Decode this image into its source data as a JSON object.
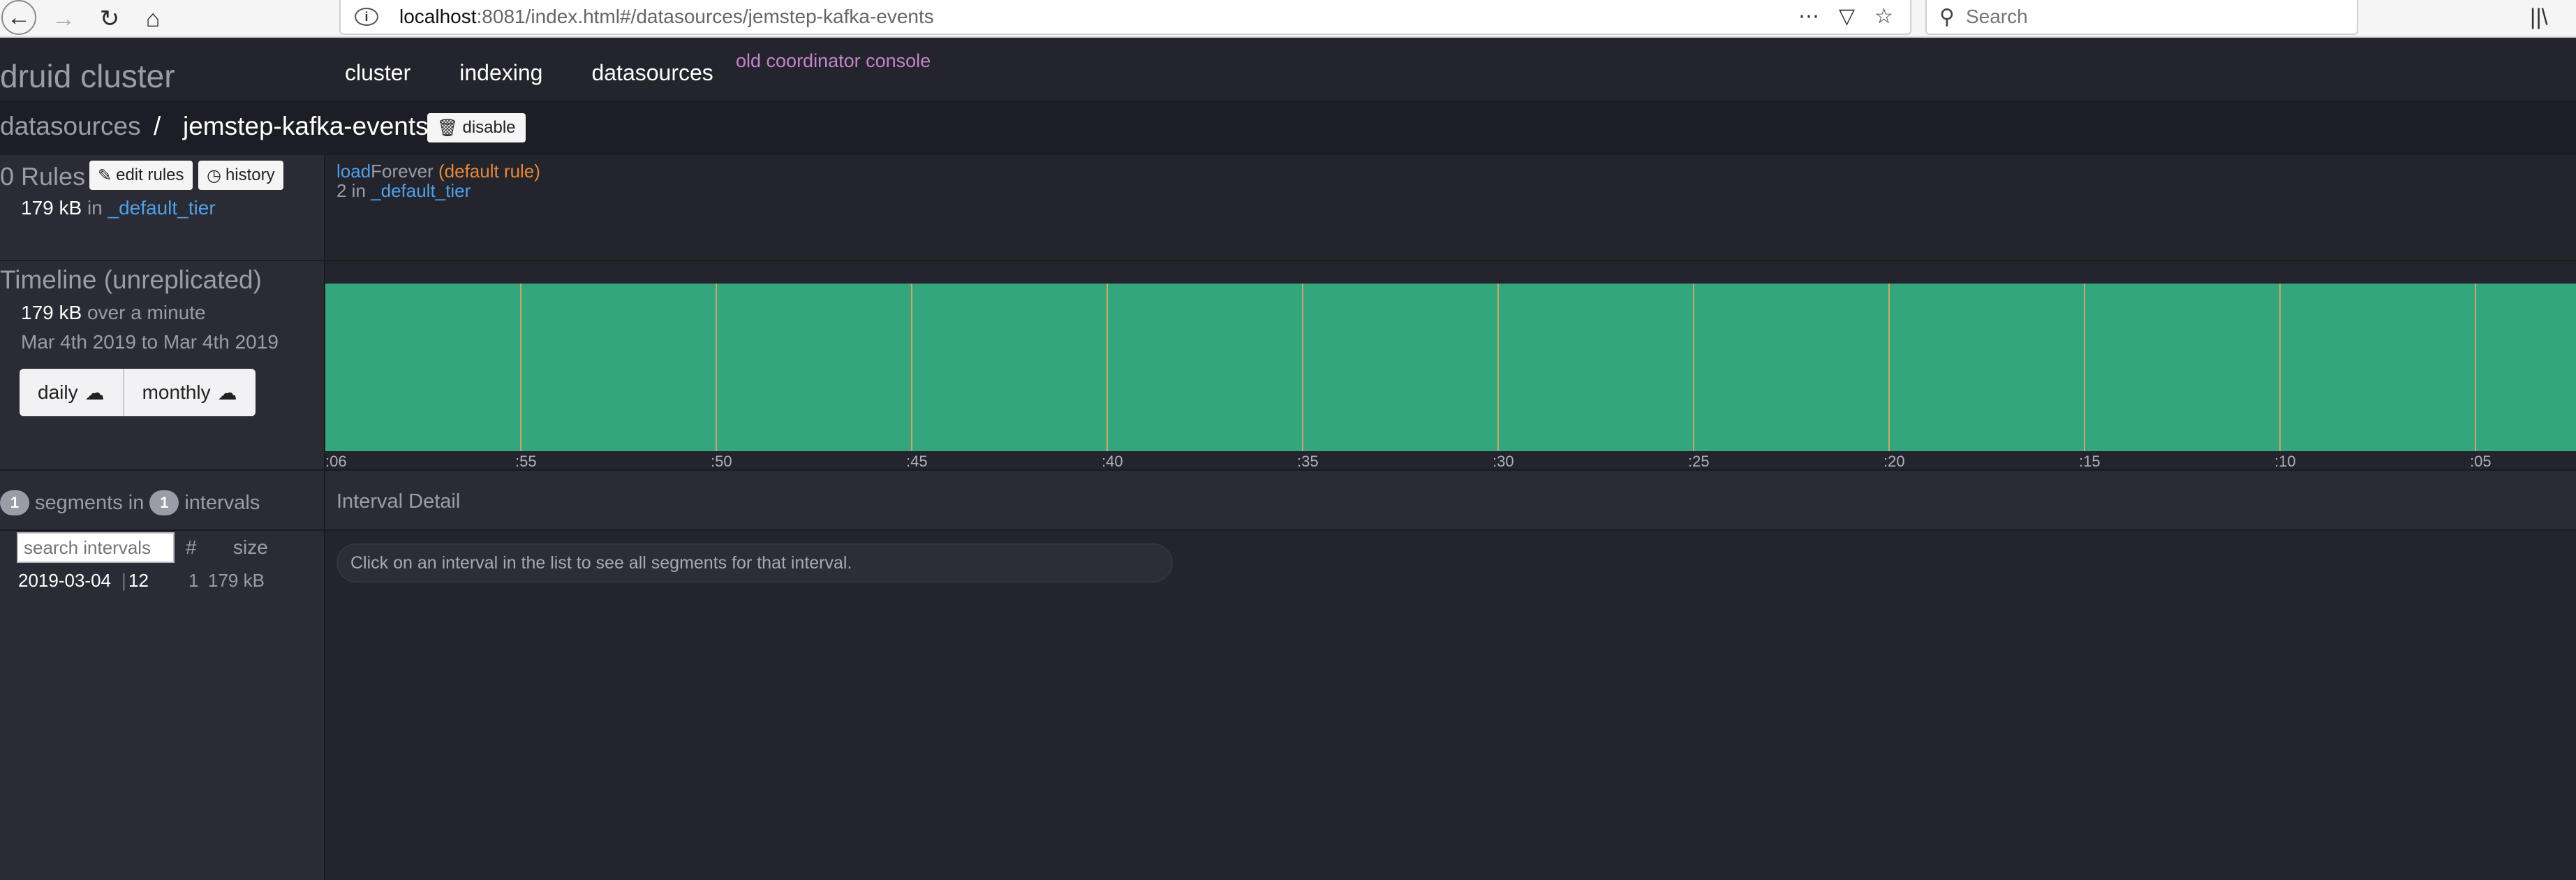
{
  "browser": {
    "url_host": "localhost",
    "url_path": ":8081/index.html#/datasources/jemstep-kafka-events",
    "search_placeholder": "Search"
  },
  "app": {
    "brand": "druid cluster",
    "nav": [
      "cluster",
      "indexing",
      "datasources"
    ],
    "old_console": "old coordinator console"
  },
  "breadcrumb": {
    "root": "datasources",
    "separator": "/",
    "current": "jemstep-kafka-events",
    "disable_label": "disable"
  },
  "rules": {
    "count_label": "0 Rules",
    "edit_label": "edit rules",
    "history_label": "history",
    "tier_size": "179 kB",
    "tier_in": "in",
    "tier_name": "_default_tier",
    "rule_load": "load",
    "rule_forever": "Forever",
    "rule_default": "(default rule)",
    "rule_replicas": "2 in",
    "rule_tier": "_default_tier"
  },
  "timeline": {
    "title": "Timeline (unreplicated)",
    "size": "179 kB",
    "size_suffix": "over a minute",
    "range": "Mar 4th 2019 to Mar 4th 2019",
    "daily_label": "daily",
    "monthly_label": "monthly",
    "fill_color": "#34a67e",
    "tick_color": "#c9a76a"
  },
  "chart_data": {
    "type": "area",
    "title": "",
    "xlabel": "",
    "ylabel": "",
    "x_tick_labels": [
      ":06",
      ":55",
      ":50",
      ":45",
      ":40",
      ":35",
      ":30",
      ":25",
      ":20",
      ":15",
      ":10",
      ":05"
    ],
    "series": [
      {
        "name": "",
        "values": [
          1,
          1,
          1,
          1,
          1,
          1,
          1,
          1,
          1,
          1,
          1,
          1
        ]
      }
    ],
    "grid": false,
    "legend": "none"
  },
  "segments": {
    "segment_count": "1",
    "segments_label": "segments in",
    "interval_count": "1",
    "intervals_label": "intervals",
    "search_placeholder": "search intervals",
    "col_count": "#",
    "col_size": "size",
    "rows": [
      {
        "date": "2019-03-04",
        "hour": "12",
        "count": "1",
        "size": "179 kB"
      }
    ]
  },
  "interval_detail": {
    "title": "Interval Detail",
    "hint": "Click on an interval in the list to see all segments for that interval."
  }
}
